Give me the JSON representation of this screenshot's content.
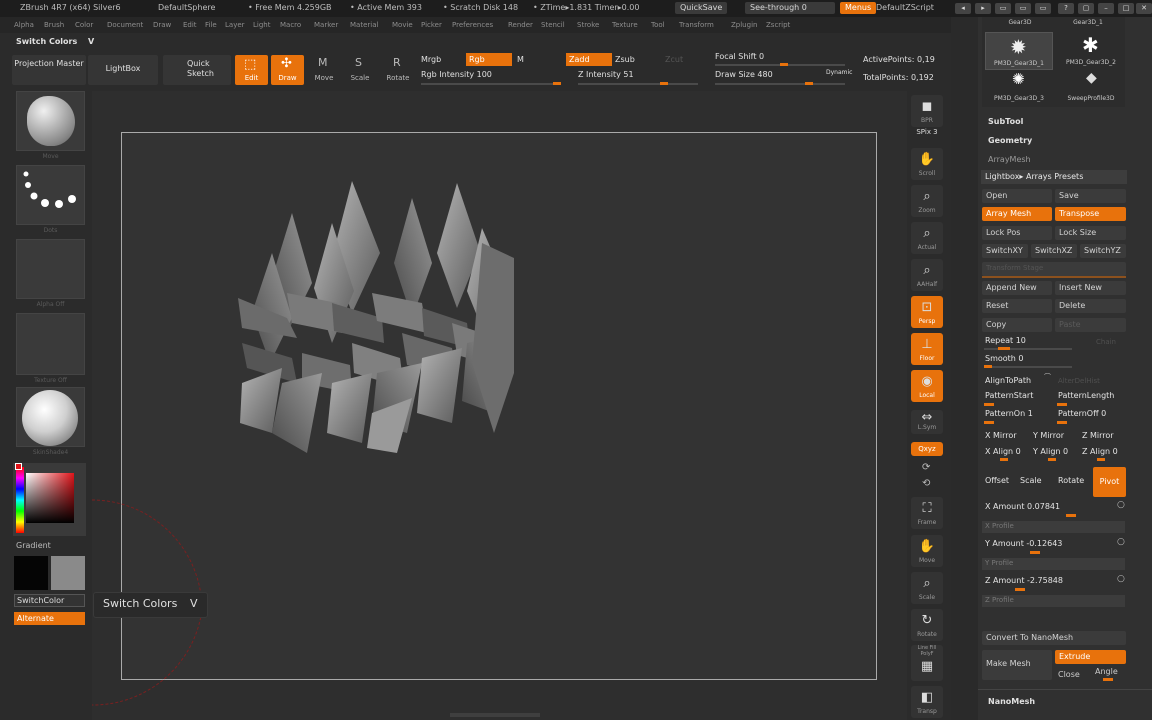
{
  "titlebar": {
    "app": "ZBrush 4R7 (x64) Silver6",
    "document": "DefaultSphere",
    "free_mem": "• Free Mem 4.259GB",
    "active_mem": "• Active Mem 393",
    "scratch": "• Scratch Disk 148",
    "ztime": "• ZTime▸1.831 Timer▸0.00",
    "quicksave": "QuickSave",
    "seethrough": "See-through   0",
    "menus": "Menus",
    "script": "DefaultZScript"
  },
  "menubar": [
    "Alpha",
    "Brush",
    "Color",
    "Document",
    "Draw",
    "Edit",
    "File",
    "Layer",
    "Light",
    "Macro",
    "Marker",
    "Material",
    "Movie",
    "Picker",
    "Preferences",
    "Render",
    "Stencil",
    "Stroke",
    "Texture",
    "Tool",
    "Transform",
    "Zplugin",
    "Zscript"
  ],
  "palette_title": "Switch Colors",
  "palette_hotkey": "V",
  "shelf": {
    "projection_master": "Projection Master",
    "lightbox": "LightBox",
    "quick_sketch": "Quick Sketch",
    "edit": "Edit",
    "draw": "Draw",
    "move": "Move",
    "scale": "Scale",
    "rotate": "Rotate",
    "mrgb": "Mrgb",
    "rgb": "Rgb",
    "m": "M",
    "rgb_intensity": "Rgb Intensity 100",
    "zadd": "Zadd",
    "zsub": "Zsub",
    "zcut": "Zcut",
    "z_intensity": "Z Intensity 51",
    "focal_shift": "Focal Shift 0",
    "draw_size": "Draw Size 480",
    "dynamic": "Dynamic",
    "active_points": "ActivePoints: 0,19",
    "total_points": "TotalPoints: 0,192"
  },
  "left": {
    "brush_caption": "Move",
    "stroke_caption": "Dots",
    "alpha_caption": "Alpha Off",
    "texture_caption": "Texture Off",
    "material_caption": "SkinShade4",
    "gradient": "Gradient",
    "switch_color": "SwitchColor",
    "alternate": "Alternate"
  },
  "tooltip": {
    "label": "Switch Colors",
    "hotkey": "V"
  },
  "right_shelf": [
    {
      "label": "BPR",
      "icon": "render-icon"
    },
    {
      "label": "SPix 3",
      "icon": ""
    },
    {
      "label": "Scroll",
      "icon": "hand-icon"
    },
    {
      "label": "Zoom",
      "icon": "zoom-icon"
    },
    {
      "label": "Actual",
      "icon": "zoom-icon"
    },
    {
      "label": "AAHalf",
      "icon": "zoom-icon"
    },
    {
      "label": "Persp",
      "icon": "persp-icon"
    },
    {
      "label": "Floor",
      "icon": "floor-icon"
    },
    {
      "label": "Local",
      "icon": "local-icon"
    },
    {
      "label": "L.Sym",
      "icon": "sym-icon"
    },
    {
      "label": "Qxyz",
      "icon": ""
    },
    {
      "label": "Frame",
      "icon": "frame-icon"
    },
    {
      "label": "Move",
      "icon": "hand-icon"
    },
    {
      "label": "Scale",
      "icon": "zoom-icon"
    },
    {
      "label": "Rotate",
      "icon": "rotate-icon"
    },
    {
      "label": "Line Fill PolyF",
      "icon": "grid-icon"
    },
    {
      "label": "Transp",
      "icon": "transp-icon"
    }
  ],
  "subtools": [
    {
      "label": "Gear3D"
    },
    {
      "label": "Gear3D_1"
    },
    {
      "label": "PM3D_Gear3D_1"
    },
    {
      "label": "PM3D_Gear3D_2"
    },
    {
      "label": "PM3D_Gear3D_3"
    },
    {
      "label": "SweepProfile3D"
    }
  ],
  "panel": {
    "subtool": "SubTool",
    "geometry": "Geometry",
    "arraymesh": "ArrayMesh",
    "lightbox_presets": "Lightbox▸ Arrays Presets",
    "open": "Open",
    "save": "Save",
    "array_mesh": "Array Mesh",
    "transpose": "Transpose",
    "lock_pos": "Lock Pos",
    "lock_size": "Lock Size",
    "switch_xy": "SwitchXY",
    "switch_xz": "SwitchXZ",
    "switch_yz": "SwitchYZ",
    "transform_stage": "Transform Stage",
    "append_new": "Append New",
    "insert_new": "Insert New",
    "reset": "Reset",
    "delete": "Delete",
    "copy": "Copy",
    "paste": "Paste",
    "repeat": "Repeat 10",
    "chain": "Chain",
    "smooth": "Smooth 0",
    "align_to_path": "AlignToPath",
    "alter_dim": "AlterDelHist",
    "pattern_start": "PatternStart",
    "pattern_length": "PatternLength",
    "pattern_on": "PatternOn 1",
    "pattern_off": "PatternOff 0",
    "x_mirror": "X Mirror",
    "y_mirror": "Y Mirror",
    "z_mirror": "Z Mirror",
    "x_align": "X Align 0",
    "y_align": "Y Align 0",
    "z_align": "Z Align 0",
    "offset": "Offset",
    "scale": "Scale",
    "rotate": "Rotate",
    "pivot": "Pivot",
    "x_amount": "X Amount 0.07841",
    "x_profile": "X Profile",
    "y_amount": "Y Amount -0.12643",
    "y_profile": "Y Profile",
    "z_amount": "Z Amount -2.75848",
    "z_profile": "Z Profile",
    "convert": "Convert To NanoMesh",
    "make_mesh": "Make Mesh",
    "extrude": "Extrude",
    "close": "Close",
    "angle": "Angle",
    "nanomesh": "NanoMesh"
  },
  "colors": {
    "accent": "#e8720c",
    "panel": "#303030",
    "bg": "#2a2a2a"
  }
}
